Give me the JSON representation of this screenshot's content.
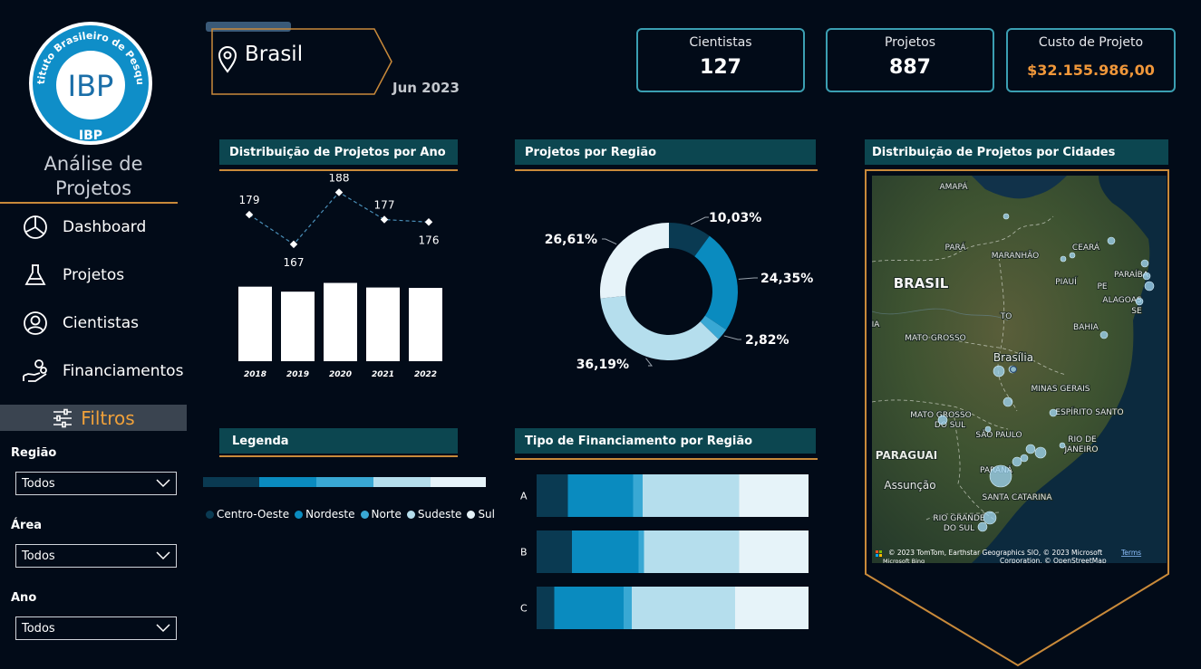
{
  "sidebar": {
    "logo": {
      "arc_text": "Instituto Brasileiro de Pesquisa",
      "mark": "IBP",
      "bottom_text": "IBP"
    },
    "title_line1": "Análise de",
    "title_line2": "Projetos",
    "nav": [
      {
        "label": "Dashboard",
        "icon": "pie-chart-icon"
      },
      {
        "label": "Projetos",
        "icon": "flask-icon"
      },
      {
        "label": "Cientistas",
        "icon": "user-icon"
      },
      {
        "label": "Financiamentos",
        "icon": "hand-coins-icon"
      }
    ],
    "filters_title": "Filtros",
    "filters": [
      {
        "label": "Região",
        "value": "Todos"
      },
      {
        "label": "Área",
        "value": "Todos"
      },
      {
        "label": "Ano",
        "value": "Todos"
      }
    ]
  },
  "header": {
    "location": "Brasil",
    "period": "Jun 2023",
    "kpis": [
      {
        "title": "Cientistas",
        "value": "127"
      },
      {
        "title": "Projetos",
        "value": "887"
      },
      {
        "title": "Custo de Projeto",
        "value": "$32.155.986,00"
      }
    ]
  },
  "sections": {
    "by_year": "Distribuição de Projetos por Ano",
    "by_region": "Projetos por Região",
    "by_city": "Distribuição de Projetos por Cidades",
    "legend": "Legenda",
    "funding": "Tipo de Financiamento por Região"
  },
  "colors": {
    "centro_oeste": "#0a3a52",
    "nordeste": "#0a8bbf",
    "norte": "#39a8d4",
    "sudeste": "#b5deed",
    "sul": "#e6f3f9",
    "accent": "#c98a3a",
    "kpi_border": "#3b9fb2",
    "cost_value": "#f0973a"
  },
  "legend": {
    "items": [
      "Centro-Oeste",
      "Nordeste",
      "Norte",
      "Sudeste",
      "Sul"
    ]
  },
  "chart_data": [
    {
      "type": "bar",
      "categories": [
        "2018",
        "2019",
        "2020",
        "2021",
        "2022"
      ],
      "values": [
        179,
        167,
        188,
        177,
        176
      ],
      "title": "Distribuição de Projetos por Ano",
      "overlay": "line"
    },
    {
      "type": "pie",
      "variant": "donut",
      "categories": [
        "Centro-Oeste",
        "Nordeste",
        "Norte",
        "Sudeste",
        "Sul"
      ],
      "values": [
        10.03,
        24.35,
        2.82,
        36.19,
        26.61
      ],
      "labels": [
        "10,03%",
        "24,35%",
        "2,82%",
        "36,19%",
        "26,61%"
      ],
      "title": "Projetos por Região"
    },
    {
      "type": "bar",
      "orientation": "horizontal",
      "stacked": "100%",
      "categories": [
        "A",
        "B",
        "C"
      ],
      "series": [
        {
          "name": "Centro-Oeste",
          "values": [
            11.5,
            13,
            6.5
          ]
        },
        {
          "name": "Nordeste",
          "values": [
            24,
            24.5,
            25.5
          ]
        },
        {
          "name": "Norte",
          "values": [
            3.5,
            2,
            3
          ]
        },
        {
          "name": "Sudeste",
          "values": [
            35.5,
            35,
            38
          ]
        },
        {
          "name": "Sul",
          "values": [
            25.5,
            25.5,
            27
          ]
        }
      ],
      "title": "Tipo de Financiamento por Região"
    }
  ],
  "map": {
    "labels": [
      {
        "text": "AMAPÁ",
        "cls": "region"
      },
      {
        "text": "PARÁ",
        "cls": "region"
      },
      {
        "text": "MARANHÃO",
        "cls": "region"
      },
      {
        "text": "CEARÁ",
        "cls": "region"
      },
      {
        "text": "PARAÍBA",
        "cls": "region"
      },
      {
        "text": "BRASIL",
        "cls": "country"
      },
      {
        "text": "PIAUÍ",
        "cls": "region"
      },
      {
        "text": "PE",
        "cls": "region"
      },
      {
        "text": "ALAGOAS",
        "cls": "region"
      },
      {
        "text": "SE",
        "cls": "region"
      },
      {
        "text": "TO",
        "cls": "region"
      },
      {
        "text": "BAHIA",
        "cls": "region"
      },
      {
        "text": "MATO GROSSO",
        "cls": "region"
      },
      {
        "text": "Brasília",
        "cls": "city"
      },
      {
        "text": "MINAS GERAIS",
        "cls": "region"
      },
      {
        "text": "MATO GROSSO",
        "cls": "region"
      },
      {
        "text": "DO SUL",
        "cls": "region"
      },
      {
        "text": "ESPÍRITO SANTO",
        "cls": "region"
      },
      {
        "text": "SÃO PAULO",
        "cls": "region"
      },
      {
        "text": "RIO DE",
        "cls": "region"
      },
      {
        "text": "JANEIRO",
        "cls": "region"
      },
      {
        "text": "PARAGUAI",
        "cls": "country2"
      },
      {
        "text": "PARANÁ",
        "cls": "region"
      },
      {
        "text": "Assunção",
        "cls": "city"
      },
      {
        "text": "SANTA CATARINA",
        "cls": "region"
      },
      {
        "text": "RIO GRANDE",
        "cls": "region"
      },
      {
        "text": "DO SUL",
        "cls": "region"
      },
      {
        "text": "IA",
        "cls": "region"
      }
    ],
    "attribution": "© 2023 TomTom, Earthstar Geographics SIO, © 2023 Microsoft",
    "attribution2": "Corporation, © OpenStreetMap",
    "terms": "Terms",
    "bing": "Microsoft Bing"
  }
}
